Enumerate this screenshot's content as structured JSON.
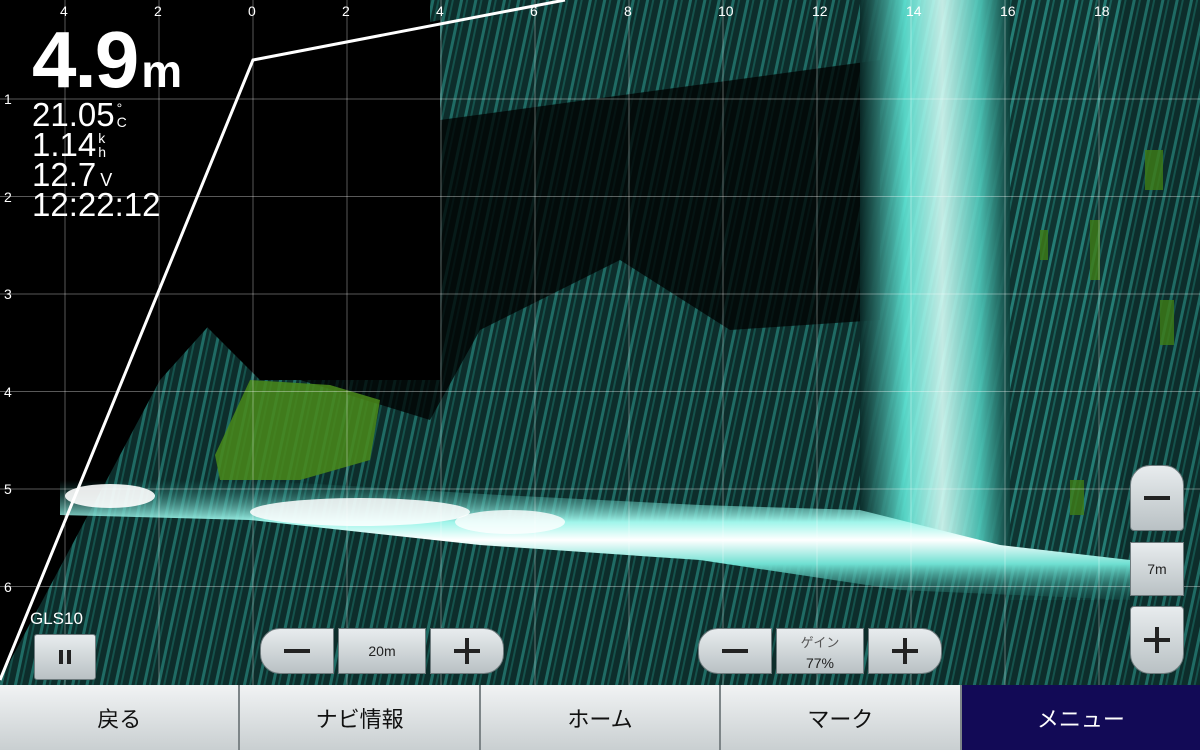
{
  "readouts": {
    "depth_value": "4.9",
    "depth_unit": "m",
    "temperature_value": "21.05",
    "temperature_unit_top": "°",
    "temperature_unit_bottom": "C",
    "speed_value": "1.14",
    "speed_unit_top": "k",
    "speed_unit_bottom": "h",
    "voltage_value": "12.7",
    "voltage_unit": "V",
    "time": "12:22:12"
  },
  "top_scale": [
    "4",
    "2",
    "0",
    "2",
    "4",
    "6",
    "8",
    "10",
    "12",
    "14",
    "16",
    "18"
  ],
  "left_scale": [
    "1",
    "2",
    "3",
    "4",
    "5",
    "6"
  ],
  "transducer": {
    "label": "GLS10",
    "pause_icon": "pause-icon"
  },
  "range_control": {
    "minus_icon": "minus-icon",
    "value": "20m",
    "plus_icon": "plus-icon"
  },
  "gain_control": {
    "minus_icon": "minus-icon",
    "label": "ゲイン",
    "value": "77%",
    "plus_icon": "plus-icon"
  },
  "depth_zoom": {
    "minus_icon": "minus-icon",
    "value": "7m",
    "plus_icon": "plus-icon"
  },
  "bottom_nav": [
    {
      "label": "戻る",
      "active": false
    },
    {
      "label": "ナビ情報",
      "active": false
    },
    {
      "label": "ホーム",
      "active": false
    },
    {
      "label": "マーク",
      "active": false
    },
    {
      "label": "メニュー",
      "active": true
    }
  ],
  "colors": {
    "sonar_cyan": "#5fe6d6",
    "sonar_bright": "#ffffff",
    "sonar_green": "#4a8a1a",
    "nav_active": "#120a56"
  }
}
